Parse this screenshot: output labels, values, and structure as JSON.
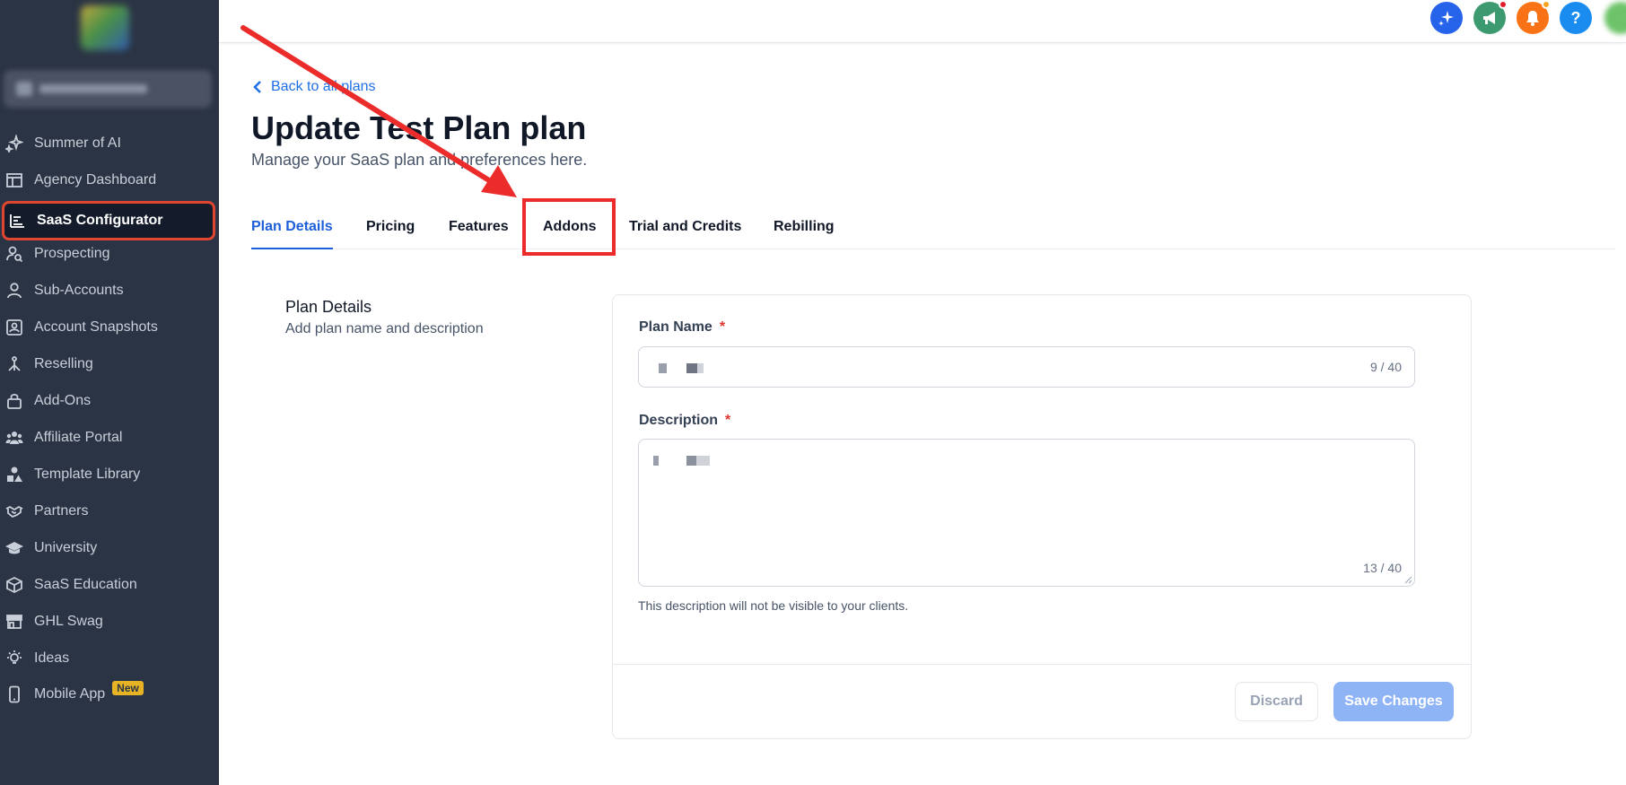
{
  "sidebar": {
    "items": [
      {
        "label": "Summer of AI",
        "icon": "sparkle-icon"
      },
      {
        "label": "Agency Dashboard",
        "icon": "dashboard-icon"
      },
      {
        "label": "SaaS Configurator",
        "icon": "bar-list-icon"
      },
      {
        "label": "Prospecting",
        "icon": "user-search-icon"
      },
      {
        "label": "Sub-Accounts",
        "icon": "user-icon"
      },
      {
        "label": "Account Snapshots",
        "icon": "snapshot-icon"
      },
      {
        "label": "Reselling",
        "icon": "branch-icon"
      },
      {
        "label": "Add-Ons",
        "icon": "lock-bag-icon"
      },
      {
        "label": "Affiliate Portal",
        "icon": "users-group-icon"
      },
      {
        "label": "Template Library",
        "icon": "shapes-icon"
      },
      {
        "label": "Partners",
        "icon": "handshake-icon"
      },
      {
        "label": "University",
        "icon": "graduation-cap-icon"
      },
      {
        "label": "SaaS Education",
        "icon": "cube-icon"
      },
      {
        "label": "GHL Swag",
        "icon": "store-icon"
      },
      {
        "label": "Ideas",
        "icon": "lightbulb-icon"
      },
      {
        "label": "Mobile App",
        "icon": "phone-icon",
        "badge": "New"
      }
    ],
    "active_index": 2
  },
  "topbar": {
    "buttons": [
      {
        "name": "ai-sparkle-button",
        "color": "#2563eb",
        "icon": "sparkle-icon"
      },
      {
        "name": "announcements-button",
        "color": "#3d9970",
        "icon": "megaphone-icon",
        "dot": "#e11d2b"
      },
      {
        "name": "notifications-button",
        "color": "#f97316",
        "icon": "bell-icon",
        "dot": "#f5a623"
      },
      {
        "name": "help-button",
        "color": "#1a8cf0",
        "icon": "question-icon",
        "glyph": "?"
      }
    ]
  },
  "main": {
    "back_link": "Back to all plans",
    "title": "Update Test Plan plan",
    "subtitle": "Manage your SaaS plan and preferences here.",
    "tabs": [
      "Plan Details",
      "Pricing",
      "Features",
      "Addons",
      "Trial and Credits",
      "Rebilling"
    ],
    "active_tab": 0,
    "highlighted_tab": 3
  },
  "section": {
    "title": "Plan Details",
    "subtitle": "Add plan name and description"
  },
  "form": {
    "plan_name_label": "Plan Name",
    "plan_name_counter": "9 / 40",
    "description_label": "Description",
    "description_counter": "13 / 40",
    "required_mark": "*",
    "hint": "This description will not be visible to your clients.",
    "discard_label": "Discard",
    "save_label": "Save Changes"
  },
  "colors": {
    "sidebar_bg": "#2b3445",
    "accent": "#1d5fd8",
    "annotation_red": "#ec2b2b",
    "save_disabled": "#8fb4f5"
  }
}
